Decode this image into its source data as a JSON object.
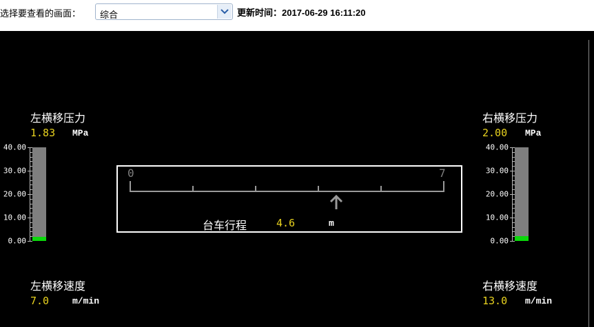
{
  "header": {
    "prompt_label": "选择要查看的画面：",
    "view_select_value": "综合",
    "update_label": "更新时间：",
    "update_time": "2017-06-29 16:11:20"
  },
  "left_pressure": {
    "title": "左横移压力",
    "value": "1.83",
    "unit": "MPa",
    "fill_fraction": 0.046
  },
  "right_pressure": {
    "title": "右横移压力",
    "value": "2.00",
    "unit": "MPa",
    "fill_fraction": 0.05
  },
  "gauge_scale": [
    "40.00",
    "30.00",
    "20.00",
    "10.00",
    "0.00"
  ],
  "left_speed": {
    "title": "左横移速度",
    "value": "7.0",
    "unit": "m/min"
  },
  "right_speed": {
    "title": "右横移速度",
    "value": "13.0",
    "unit": "m/min"
  },
  "trolley": {
    "label": "台车行程",
    "value": "4.6",
    "unit": "m",
    "scale_min": "0",
    "scale_max": "7",
    "position": 4.6,
    "range": [
      0,
      7
    ]
  },
  "colors": {
    "value_text": "#e8d21f",
    "bar_fill": "#0bd80b",
    "bar_bg": "#7f7f7f"
  },
  "icons": {
    "select_arrow": "chevron-down-icon",
    "position_marker": "arrow-up-icon"
  }
}
